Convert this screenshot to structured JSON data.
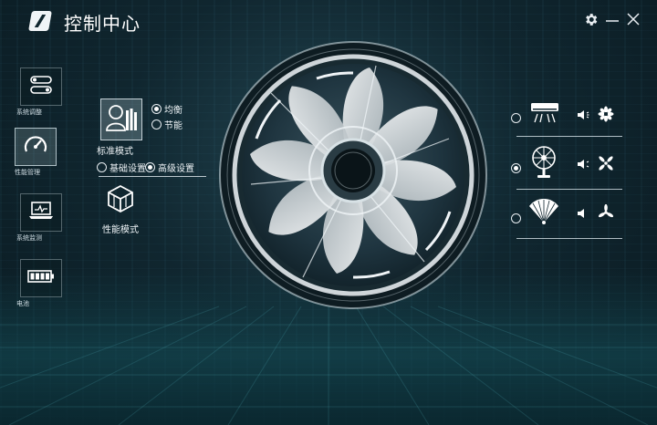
{
  "window": {
    "title": "控制中心",
    "settings_icon": "gear-icon",
    "minimize_icon": "minimize-icon",
    "close_icon": "close-icon"
  },
  "sidebar": {
    "items": [
      {
        "label": "系统调整",
        "icon": "toggle-switches-icon",
        "active": false
      },
      {
        "label": "性能管理",
        "icon": "speedometer-icon",
        "active": true
      },
      {
        "label": "系统监测",
        "icon": "laptop-monitor-icon",
        "active": false
      },
      {
        "label": "电池",
        "icon": "battery-icon",
        "active": false
      }
    ]
  },
  "modes": {
    "standard": {
      "label": "标准模式",
      "icon": "user-books-icon",
      "options": [
        {
          "label": "均衡",
          "selected": true
        },
        {
          "label": "节能",
          "selected": false
        }
      ]
    },
    "settings_toggle": [
      {
        "label": "基础设置",
        "selected": false
      },
      {
        "label": "高级设置",
        "selected": true
      }
    ],
    "performance": {
      "label": "性能模式",
      "icon": "cube-icon"
    }
  },
  "fan_profiles": [
    {
      "icon": "air-conditioner-icon",
      "sound_icon": "speaker-low-icon",
      "speed_icon": "fan-dense-icon",
      "selected": false
    },
    {
      "icon": "desk-fan-icon",
      "sound_icon": "speaker-low-icon",
      "speed_icon": "fan-four-blade-icon",
      "selected": true
    },
    {
      "icon": "hand-fan-icon",
      "sound_icon": "speaker-low-icon",
      "speed_icon": "fan-three-blade-icon",
      "selected": false
    }
  ],
  "colors": {
    "background": "#10262f",
    "accent": "#e8f1f5"
  }
}
